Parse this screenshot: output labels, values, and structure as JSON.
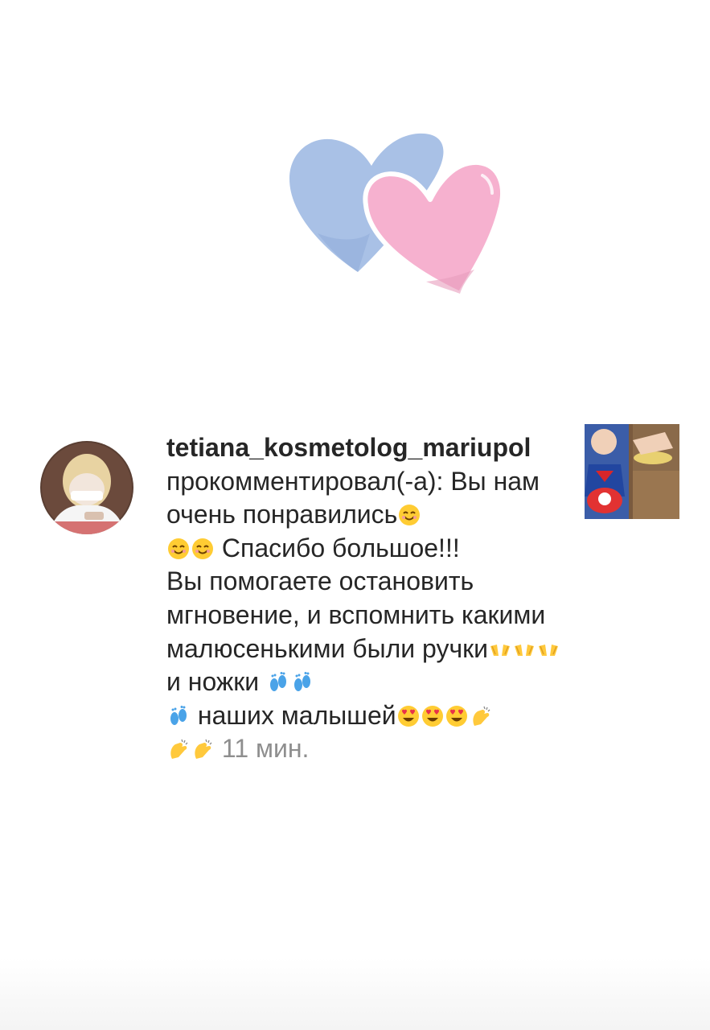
{
  "notification": {
    "username": "tetiana_kosmetolog_mariupol",
    "action_text": "прокомментировал(-а):",
    "comment_parts": {
      "line1": "Вы нам очень понравились",
      "thanks": "Спасибо большое!!!",
      "sentence1": "Вы  помогаете остановить мгновение, и вспомнить какими малюсенькими были ручки",
      "and_feet": "и ножки",
      "our_babies": "наших малышей"
    },
    "timestamp": "11 мин."
  },
  "icons": {
    "hearts": "two-hearts-icon",
    "smile": "smiling-face-icon",
    "hands": "open-hands-icon",
    "feet": "footprints-icon",
    "heart_eyes": "heart-eyes-face-icon",
    "clap": "clapping-hands-icon"
  },
  "colors": {
    "heart_blue": "#a9c1e6",
    "heart_pink": "#f6b1cf",
    "text": "#262626",
    "timestamp": "#8e8e8e"
  }
}
